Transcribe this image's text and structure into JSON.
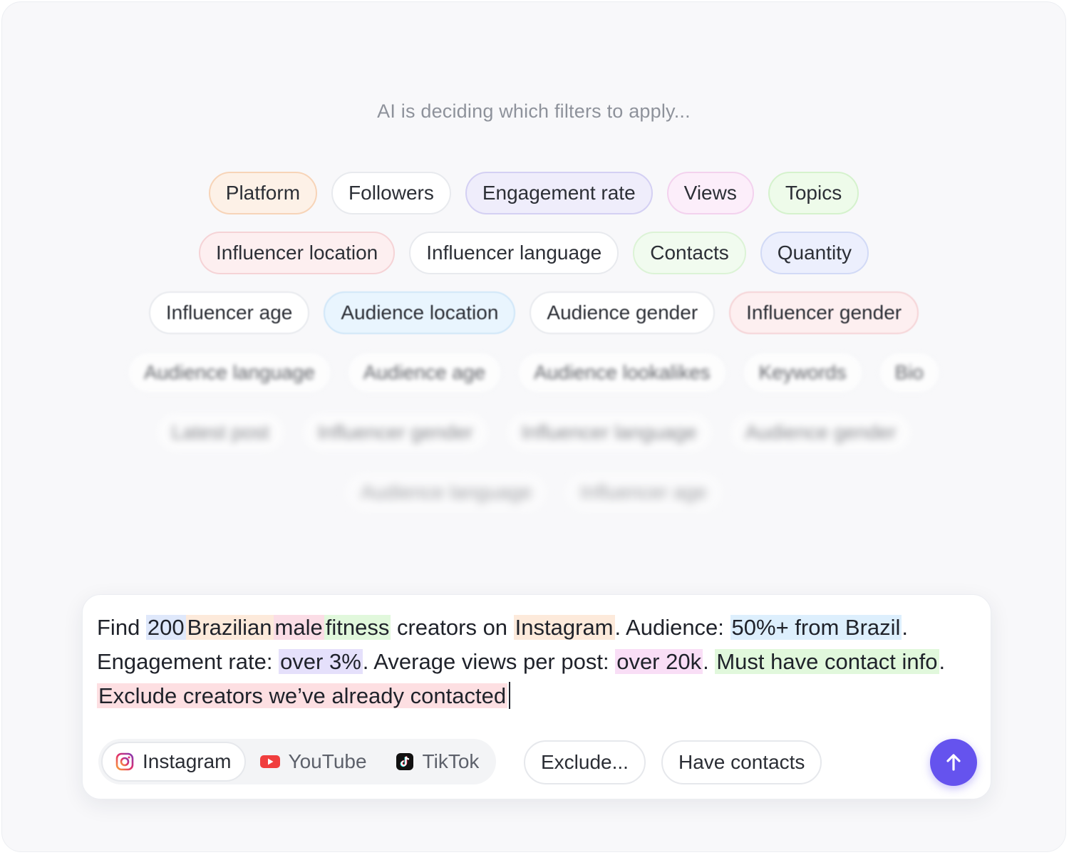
{
  "status_text": "AI is deciding which filters to apply...",
  "filter_rows": [
    [
      "Platform",
      "Followers",
      "Engagement rate",
      "Views",
      "Topics"
    ],
    [
      "Influencer location",
      "Influencer language",
      "Contacts",
      "Quantity"
    ],
    [
      "Influencer age",
      "Audience location",
      "Audience gender",
      "Influencer gender"
    ],
    [
      "Audience language",
      "Audience age",
      "Audience lookalikes",
      "Keywords",
      "Bio"
    ],
    [
      "Latest post",
      "Influencer gender",
      "Influencer language",
      "Audience gender"
    ],
    [
      "Audience language",
      "Influencer age"
    ]
  ],
  "prompt": {
    "segments": [
      "Find ",
      "200",
      " ",
      "Brazilian",
      " ",
      "male",
      " ",
      "fitness",
      " creators on ",
      "Instagram",
      ". Audience: ",
      "50%+ from Brazil",
      ". Engagement rate: ",
      "over 3%",
      ". Average views per post: ",
      "over 20k",
      ". ",
      "Must have contact info",
      ". ",
      "Exclude creators we’ve already contacted"
    ]
  },
  "platforms": {
    "instagram": "Instagram",
    "youtube": "YouTube",
    "tiktok": "TikTok"
  },
  "actions": {
    "exclude": "Exclude...",
    "have_contacts": "Have contacts"
  },
  "colors": {
    "accent": "#6553ee",
    "instagram": "#e1306c",
    "youtube": "#f03e3e",
    "tiktok": "#111111"
  }
}
